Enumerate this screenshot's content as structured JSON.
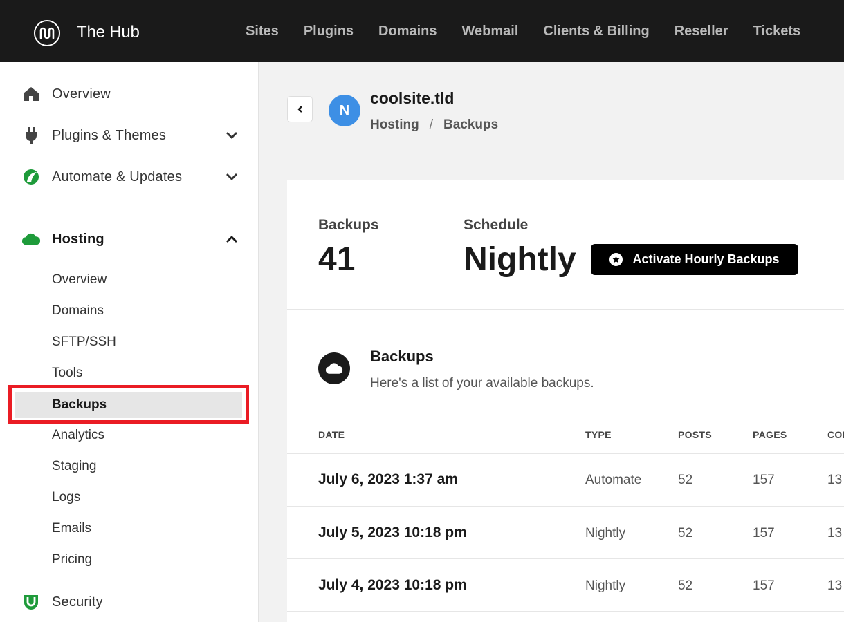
{
  "app": {
    "brand": "The Hub",
    "nav": [
      "Sites",
      "Plugins",
      "Domains",
      "Webmail",
      "Clients & Billing",
      "Reseller",
      "Tickets"
    ]
  },
  "sidebar": {
    "items": [
      {
        "label": "Overview",
        "icon": "home-icon"
      },
      {
        "label": "Plugins & Themes",
        "icon": "plug-icon"
      },
      {
        "label": "Automate & Updates",
        "icon": "automate-icon"
      },
      {
        "label": "Hosting",
        "icon": "cloud-icon"
      },
      {
        "label": "Security",
        "icon": "shield-icon"
      }
    ],
    "hosting_sub": [
      "Overview",
      "Domains",
      "SFTP/SSH",
      "Tools",
      "Backups",
      "Analytics",
      "Staging",
      "Logs",
      "Emails",
      "Pricing"
    ],
    "active_sub": "Backups"
  },
  "header": {
    "avatar_letter": "N",
    "site_name": "coolsite.tld",
    "breadcrumb": [
      "Hosting",
      "Backups"
    ],
    "breadcrumb_sep": "/"
  },
  "stats": {
    "backups_label": "Backups",
    "backups_value": "41",
    "schedule_label": "Schedule",
    "schedule_value": "Nightly",
    "activate_button": "Activate Hourly Backups"
  },
  "section": {
    "title": "Backups",
    "description": "Here's a list of your available backups."
  },
  "table": {
    "columns": [
      "DATE",
      "TYPE",
      "POSTS",
      "PAGES",
      "COMMENTS"
    ],
    "rows": [
      {
        "date": "July 6, 2023 1:37 am",
        "type": "Automate",
        "posts": "52",
        "pages": "157",
        "comments": "13"
      },
      {
        "date": "July 5, 2023 10:18 pm",
        "type": "Nightly",
        "posts": "52",
        "pages": "157",
        "comments": "13"
      },
      {
        "date": "July 4, 2023 10:18 pm",
        "type": "Nightly",
        "posts": "52",
        "pages": "157",
        "comments": "13"
      }
    ]
  },
  "colors": {
    "topbar": "#1a1a1a",
    "accent_green": "#1e9b3a",
    "avatar_blue": "#3d8fe5",
    "highlight_red": "#ea1c24"
  }
}
